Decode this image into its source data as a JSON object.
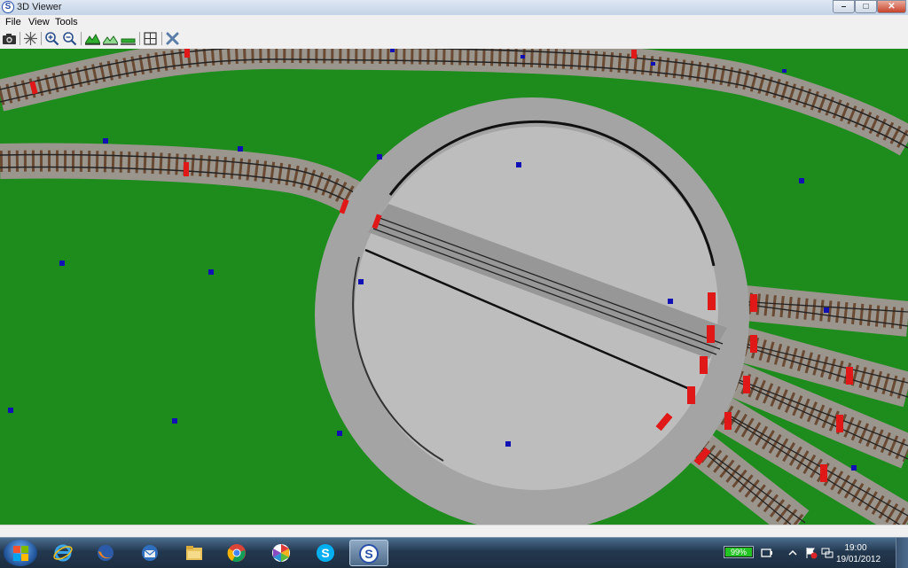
{
  "window": {
    "title": "3D Viewer",
    "app_icon_letter": "S",
    "controls": {
      "minimize": "–",
      "maximize": "□",
      "close": "✕"
    }
  },
  "menu": {
    "items": [
      "File",
      "View",
      "Tools"
    ]
  },
  "toolbar": {
    "buttons": [
      "camera-icon",
      "axes-icon",
      "zoom-in-icon",
      "zoom-out-icon",
      "terrain-high-icon",
      "terrain-outline-icon",
      "terrain-flat-icon",
      "fit-view-icon",
      "close-view-icon"
    ]
  },
  "scene": {
    "ground_color": "#1d8c1d",
    "turntable_color": "#a9a9a9",
    "marker_color": "#1010b4",
    "buffer_color": "#e01818"
  },
  "taskbar": {
    "apps": [
      "internet-explorer-icon",
      "firefox-icon",
      "thunderbird-icon",
      "file-explorer-icon",
      "chrome-icon",
      "picasa-icon",
      "skype-icon",
      "3d-viewer-icon"
    ],
    "battery": {
      "label": "99%",
      "level": 0.99
    },
    "clock": {
      "time": "19:00",
      "date": "19/01/2012"
    }
  }
}
